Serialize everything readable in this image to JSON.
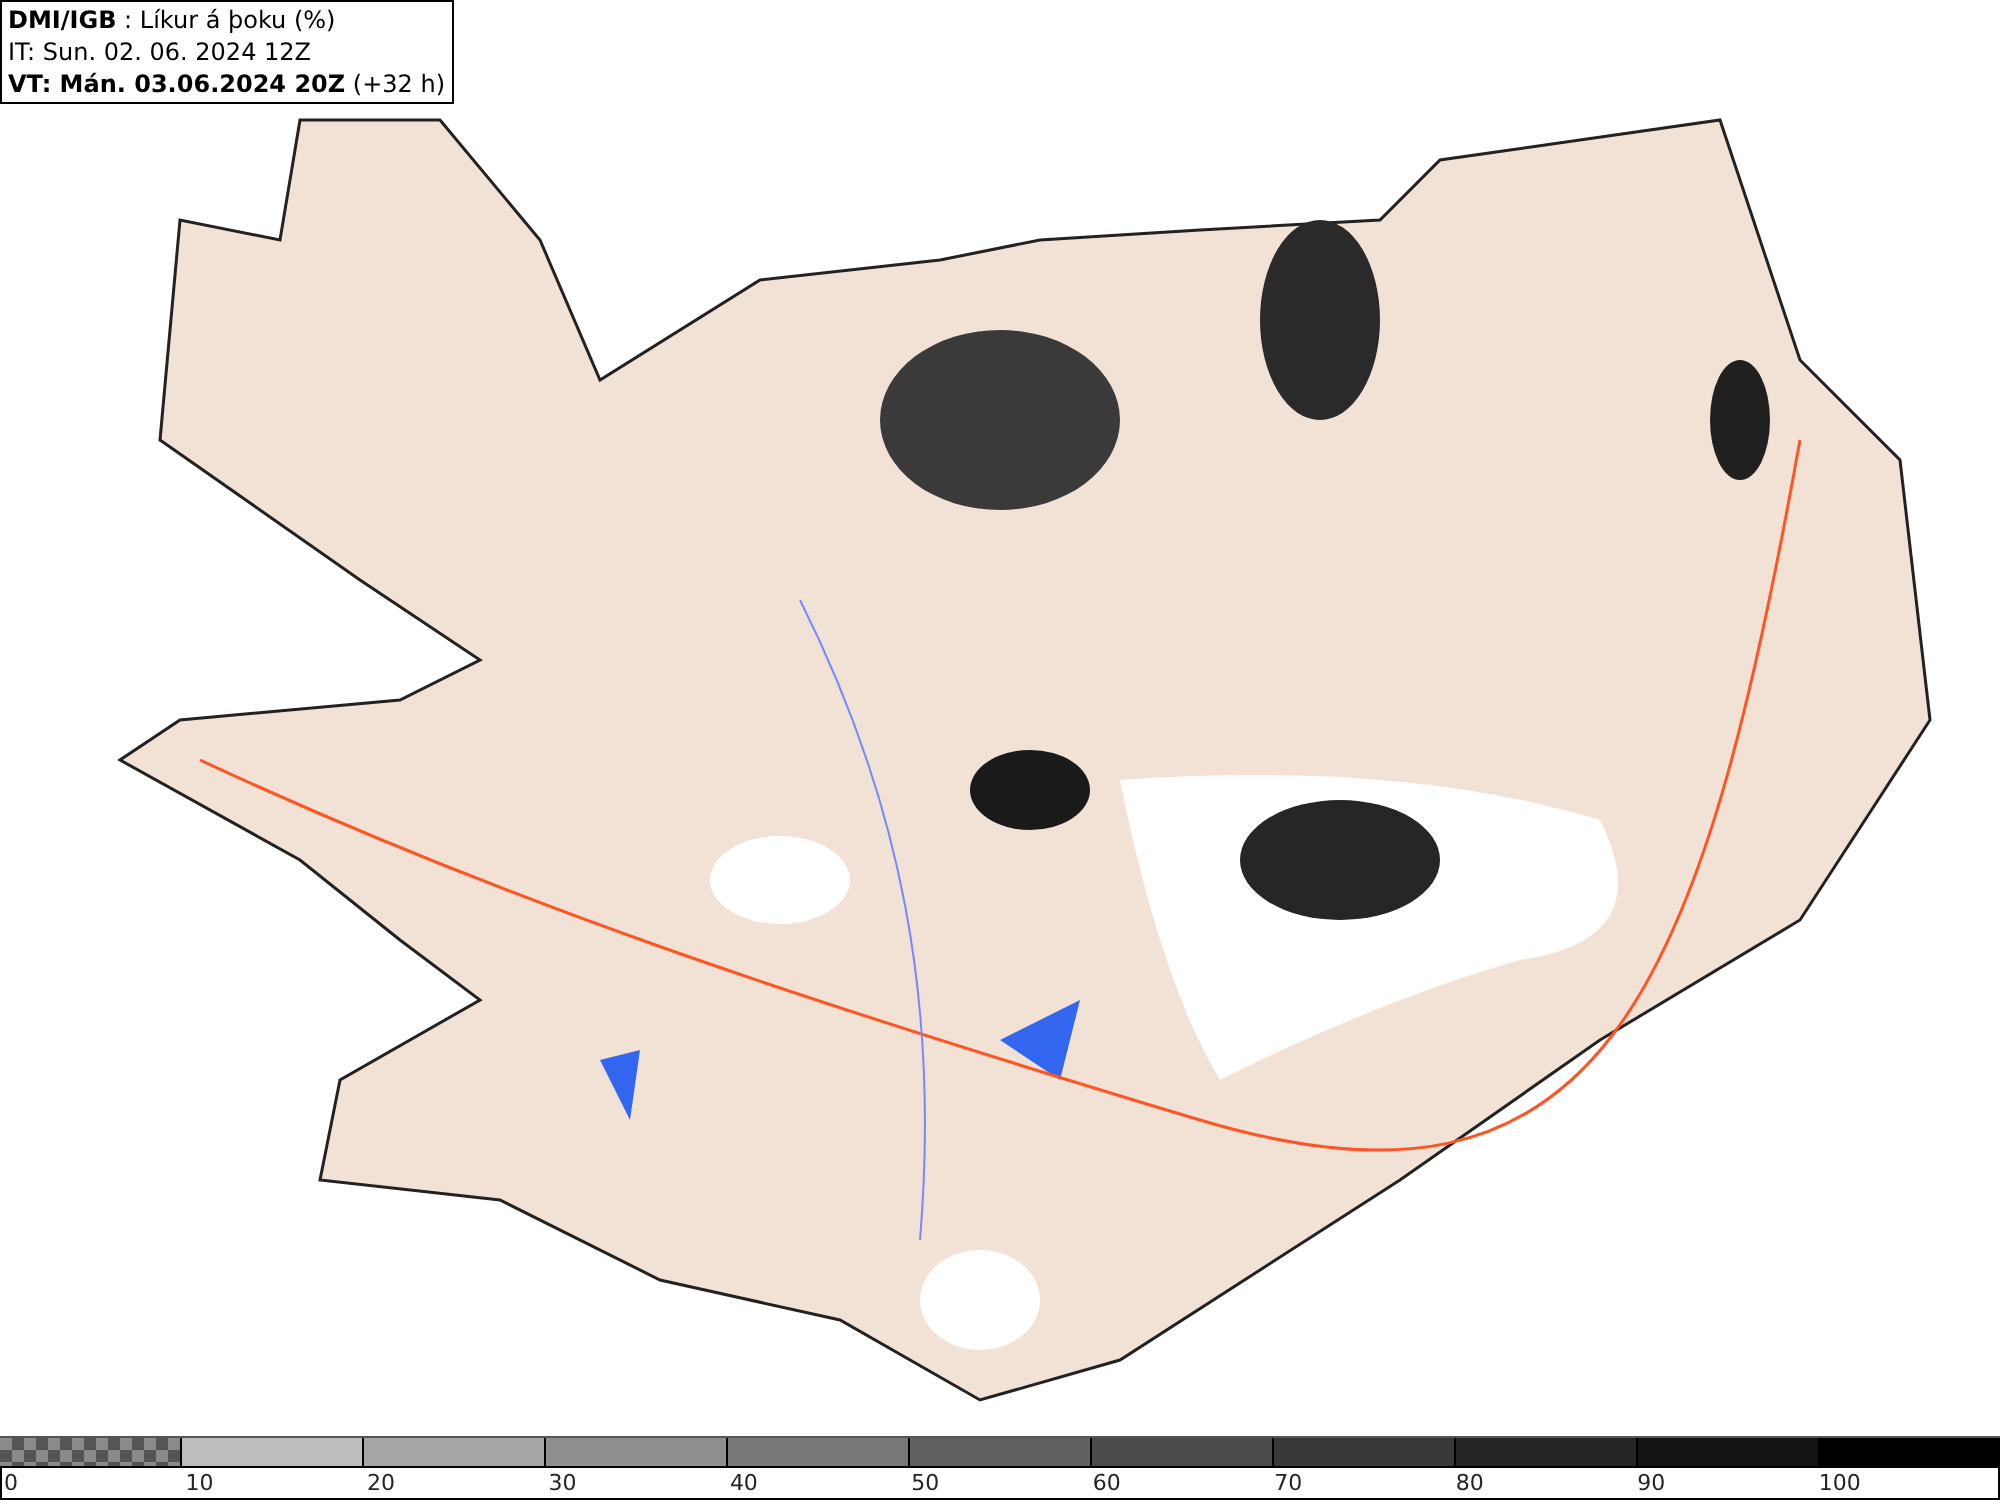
{
  "header": {
    "title": "**DMI/IGB** : Líkur á þoku (%)",
    "initial_time": "IT: Sun. 02. 06. 2024 12Z",
    "valid_time": "**VT: Mán. 03.06.2024 20Z** (+32 h)"
  },
  "colorbar": {
    "bins": [
      {
        "kind": "checkered",
        "color": "#8a8a8a"
      },
      {
        "kind": "solid",
        "color": "#bdbdbd"
      },
      {
        "kind": "solid",
        "color": "#a6a6a6"
      },
      {
        "kind": "solid",
        "color": "#8f8f8f"
      },
      {
        "kind": "solid",
        "color": "#787878"
      },
      {
        "kind": "solid",
        "color": "#616161"
      },
      {
        "kind": "solid",
        "color": "#4b4b4b"
      },
      {
        "kind": "solid",
        "color": "#383838"
      },
      {
        "kind": "solid",
        "color": "#252525"
      },
      {
        "kind": "solid",
        "color": "#141414"
      },
      {
        "kind": "solid",
        "color": "#000000"
      }
    ],
    "ticks": [
      "0",
      "10",
      "20",
      "30",
      "40",
      "50",
      "60",
      "70",
      "80",
      "90",
      "100"
    ]
  }
}
